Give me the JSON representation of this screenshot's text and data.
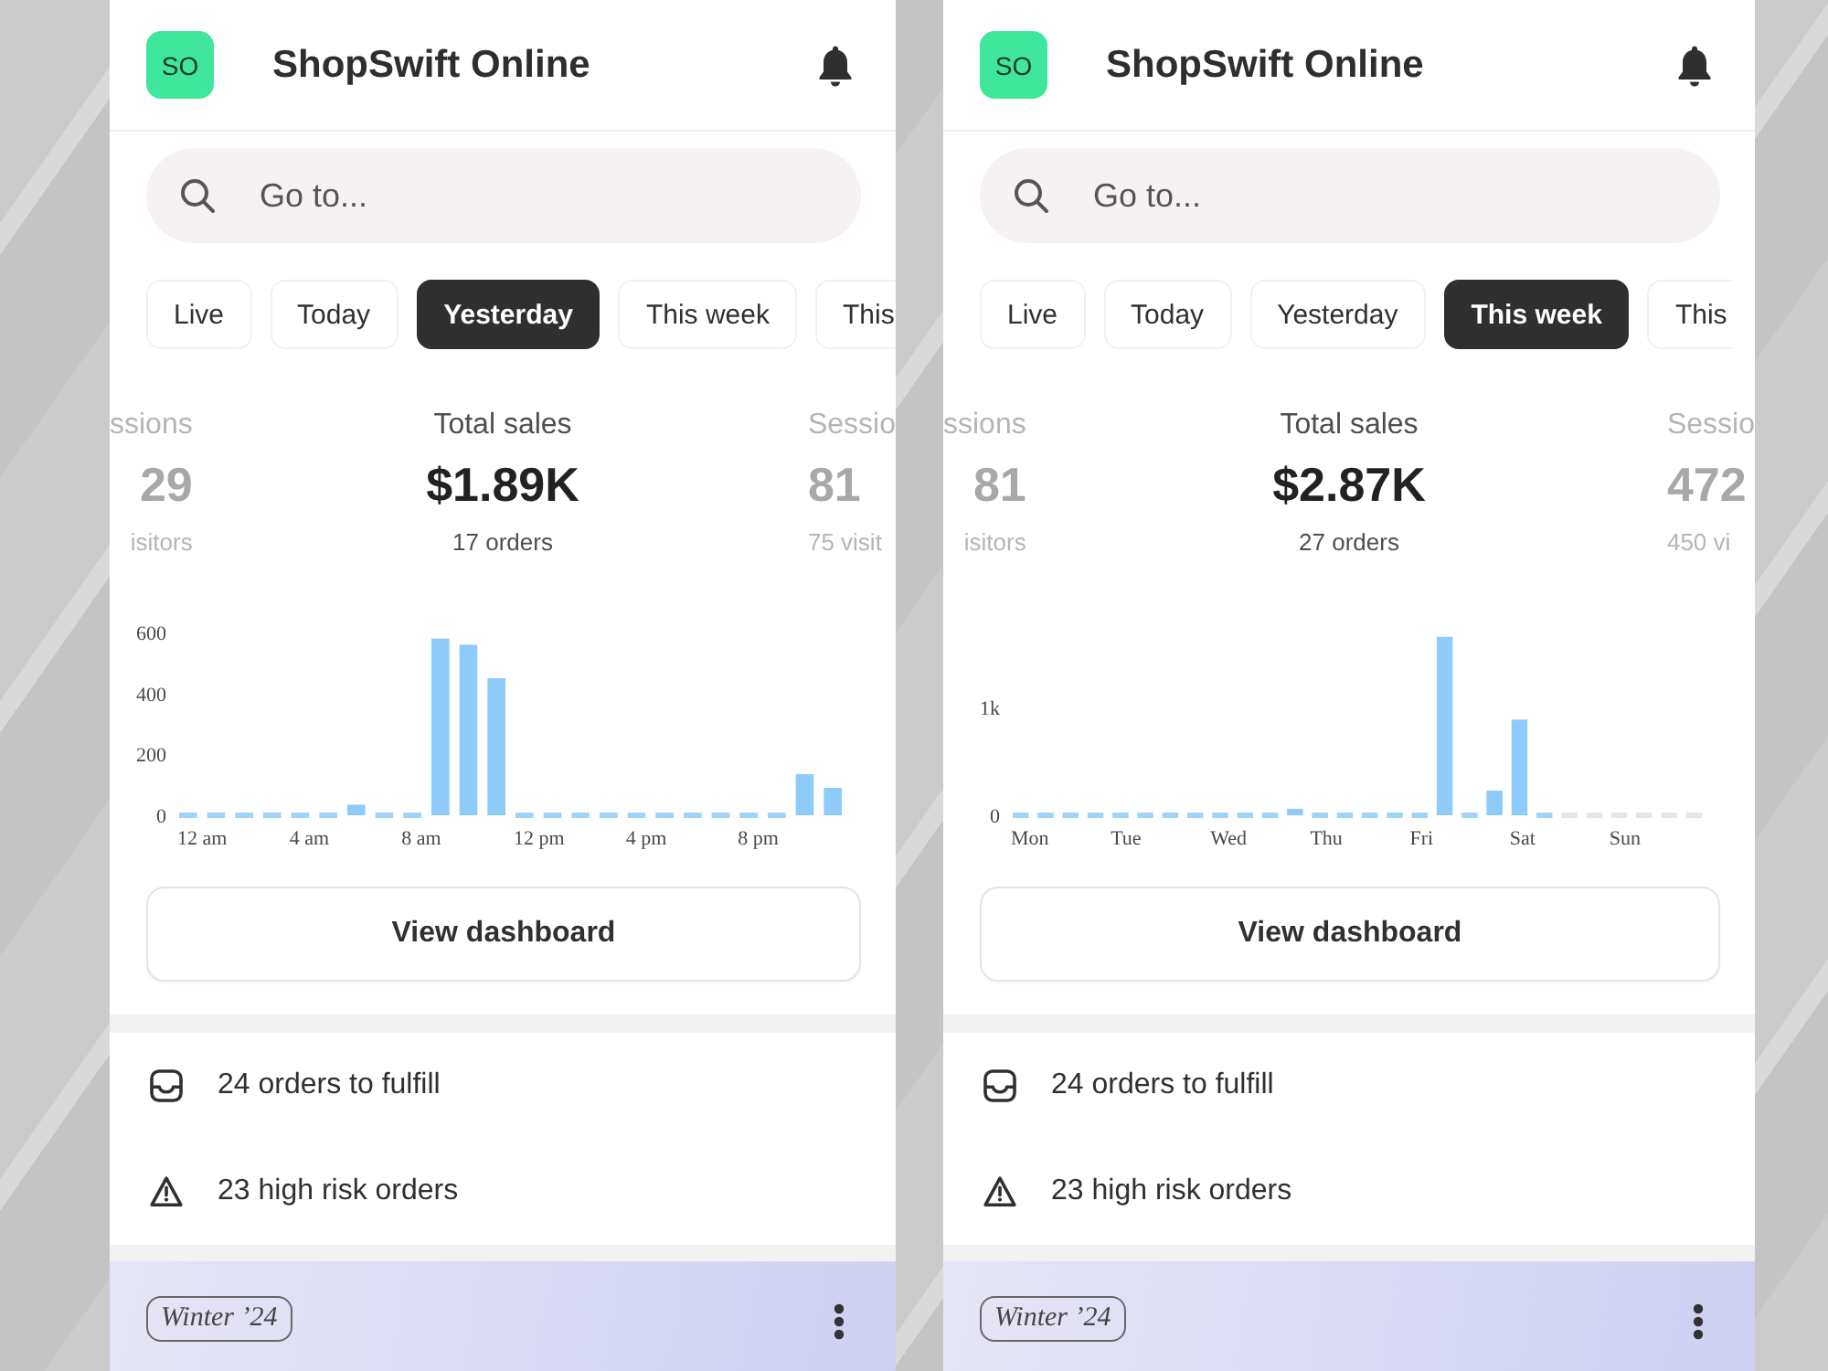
{
  "screens": [
    {
      "store": {
        "initials": "SO",
        "name": "ShopSwift Online"
      },
      "search": {
        "placeholder": "Go to..."
      },
      "tabs": [
        {
          "label": "Live",
          "selected": false
        },
        {
          "label": "Today",
          "selected": false
        },
        {
          "label": "Yesterday",
          "selected": true
        },
        {
          "label": "This week",
          "selected": false
        },
        {
          "label": "This",
          "selected": false
        }
      ],
      "metrics": [
        {
          "kind": "side",
          "label": "ssions",
          "value": "29",
          "detail": "isitors"
        },
        {
          "kind": "main",
          "label": "Total sales",
          "value": "$1.89K",
          "detail": "17 orders"
        },
        {
          "kind": "side",
          "label": "Sessio",
          "value": "81",
          "detail": "75 visit"
        }
      ],
      "chart_data": {
        "type": "bar",
        "categories": [
          "12 am",
          null,
          null,
          null,
          "4 am",
          null,
          null,
          null,
          "8 am",
          null,
          null,
          null,
          "12 pm",
          null,
          null,
          null,
          "4 pm",
          null,
          null,
          null,
          "8 pm",
          null,
          null,
          null
        ],
        "values": [
          0,
          0,
          0,
          0,
          0,
          0,
          35,
          0,
          0,
          580,
          560,
          450,
          0,
          0,
          0,
          0,
          0,
          0,
          0,
          0,
          0,
          0,
          135,
          90
        ],
        "yticks": [
          0,
          200,
          400,
          600
        ],
        "ylim": [
          0,
          600
        ]
      },
      "dashboard_button": "View dashboard",
      "tasks": [
        {
          "kind": "fulfill",
          "text": "24 orders to fulfill"
        },
        {
          "kind": "risk",
          "text": "23 high risk orders"
        }
      ],
      "banner": {
        "badge": "Winter ’24"
      }
    },
    {
      "store": {
        "initials": "SO",
        "name": "ShopSwift Online"
      },
      "search": {
        "placeholder": "Go to..."
      },
      "tabs": [
        {
          "label": "Live",
          "selected": false
        },
        {
          "label": "Today",
          "selected": false
        },
        {
          "label": "Yesterday",
          "selected": false
        },
        {
          "label": "This week",
          "selected": true
        },
        {
          "label": "This",
          "selected": false
        }
      ],
      "metrics": [
        {
          "kind": "side",
          "label": "ssions",
          "value": "81",
          "detail": "isitors"
        },
        {
          "kind": "main",
          "label": "Total sales",
          "value": "$2.87K",
          "detail": "27 orders"
        },
        {
          "kind": "side",
          "label": "Sessio",
          "value": "472",
          "detail": "450 vi"
        }
      ],
      "chart_data": {
        "type": "bar",
        "categories": [
          "Mon",
          null,
          null,
          null,
          "Tue",
          null,
          null,
          null,
          "Wed",
          null,
          null,
          null,
          "Thu",
          null,
          null,
          null,
          "Fri",
          null,
          null,
          null,
          "Sat",
          null,
          null,
          null,
          "Sun",
          null,
          null,
          null
        ],
        "values": [
          0,
          0,
          0,
          0,
          0,
          0,
          0,
          0,
          0,
          0,
          0,
          60,
          0,
          0,
          0,
          0,
          0,
          1660,
          0,
          230,
          890,
          0,
          null,
          null,
          null,
          null,
          null,
          null
        ],
        "yticks": [
          0,
          {
            "value": 1000,
            "label": "1k"
          }
        ],
        "ylim": [
          0,
          1700
        ]
      },
      "dashboard_button": "View dashboard",
      "tasks": [
        {
          "kind": "fulfill",
          "text": "24 orders to fulfill"
        },
        {
          "kind": "risk",
          "text": "23 high risk orders"
        }
      ],
      "banner": {
        "badge": "Winter ’24"
      }
    }
  ]
}
